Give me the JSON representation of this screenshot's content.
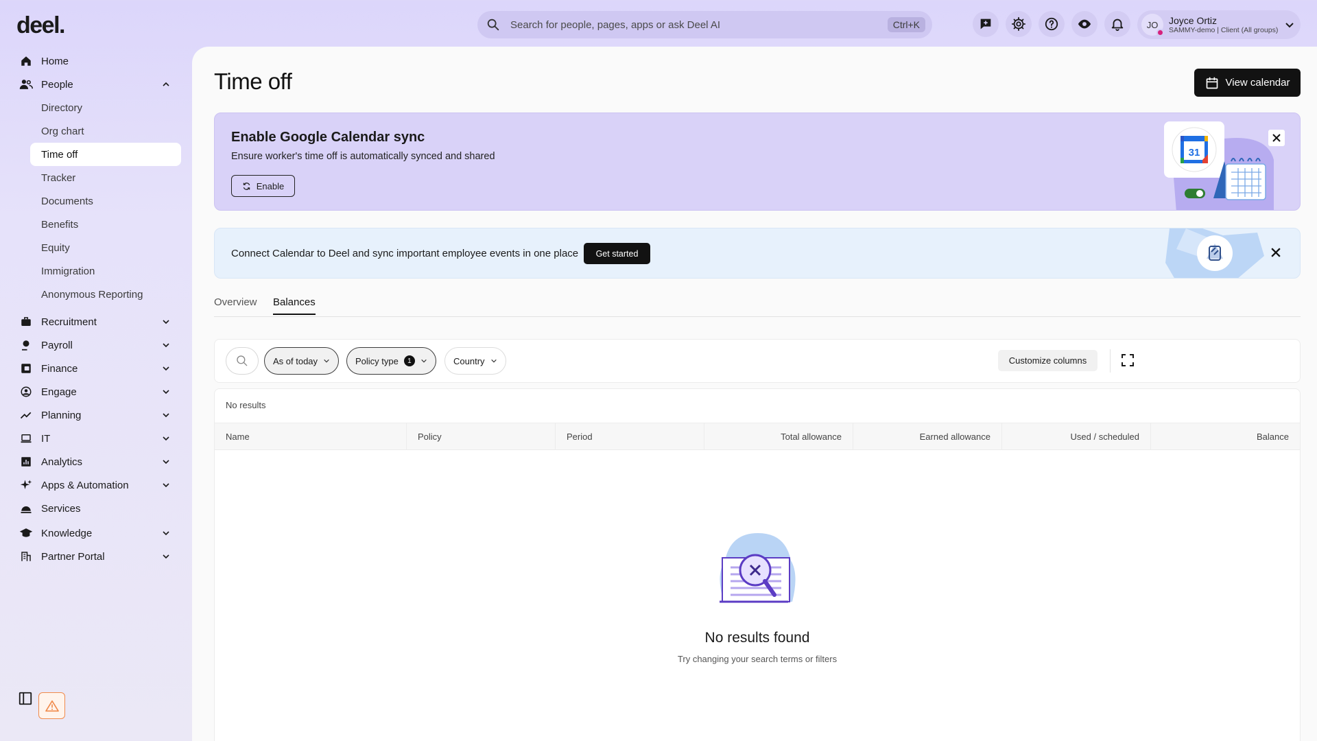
{
  "brand": {
    "logo": "deel."
  },
  "search": {
    "placeholder": "Search for people, pages, apps or ask Deel AI",
    "shortcut": "Ctrl+K"
  },
  "user": {
    "initials": "JO",
    "name": "Joyce Ortiz",
    "org": "SAMMY-demo | Client (All groups)"
  },
  "top_icons": [
    "feedback-icon",
    "settings-icon",
    "help-icon",
    "eye-icon",
    "bell-icon"
  ],
  "sidebar": {
    "items": [
      {
        "label": "Home",
        "icon": "home-icon"
      },
      {
        "label": "People",
        "icon": "people-icon",
        "expanded": true
      },
      {
        "label": "Recruitment",
        "icon": "briefcase-icon"
      },
      {
        "label": "Payroll",
        "icon": "payroll-icon"
      },
      {
        "label": "Finance",
        "icon": "finance-icon"
      },
      {
        "label": "Engage",
        "icon": "engage-icon"
      },
      {
        "label": "Planning",
        "icon": "planning-icon"
      },
      {
        "label": "IT",
        "icon": "laptop-icon"
      },
      {
        "label": "Analytics",
        "icon": "analytics-icon"
      },
      {
        "label": "Apps & Automation",
        "icon": "sparkle-icon"
      },
      {
        "label": "Services",
        "icon": "services-icon"
      },
      {
        "label": "Knowledge",
        "icon": "graduation-icon"
      },
      {
        "label": "Partner Portal",
        "icon": "building-icon"
      }
    ],
    "people_sub": [
      "Directory",
      "Org chart",
      "Time off",
      "Tracker",
      "Documents",
      "Benefits",
      "Equity",
      "Immigration",
      "Anonymous Reporting"
    ],
    "active_sub": "Time off"
  },
  "page": {
    "title": "Time off",
    "view_calendar": "View calendar"
  },
  "banner_google": {
    "title": "Enable Google Calendar sync",
    "subtitle": "Ensure worker's time off is automatically synced and shared",
    "button": "Enable",
    "calendar_day": "31"
  },
  "banner_connect": {
    "text": "Connect Calendar to Deel and sync important employee events in one place",
    "button": "Get started"
  },
  "tabs": [
    {
      "label": "Overview",
      "active": false
    },
    {
      "label": "Balances",
      "active": true
    }
  ],
  "filters": {
    "as_of": "As of today",
    "policy_type": "Policy type",
    "policy_count": "1",
    "country": "Country",
    "customize": "Customize columns"
  },
  "table": {
    "status": "No results",
    "columns": [
      "Name",
      "Policy",
      "Period",
      "Total allowance",
      "Earned allowance",
      "Used / scheduled",
      "Balance"
    ]
  },
  "empty": {
    "title": "No results found",
    "subtitle": "Try changing your search terms or filters"
  },
  "colors": {
    "accent_purple": "#d9d2f8",
    "dark_button": "#121212",
    "warning": "#f08a4b"
  }
}
